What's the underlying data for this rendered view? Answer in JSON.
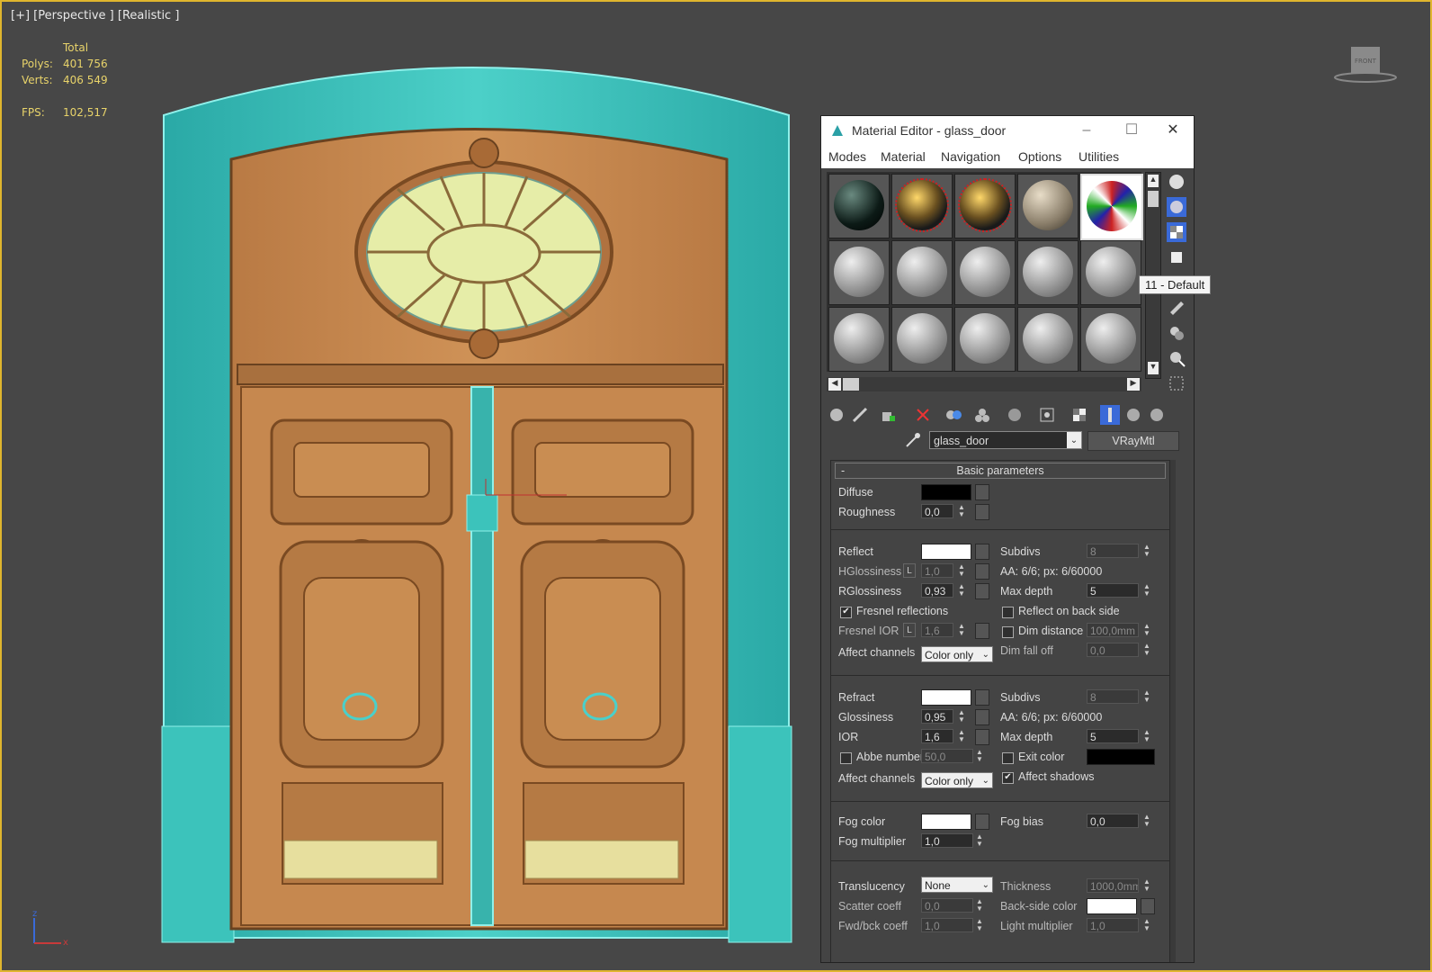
{
  "viewport": {
    "label": "[+] [Perspective ] [Realistic ]",
    "stats": {
      "header": "Total",
      "rows": [
        {
          "key": "Polys:",
          "value": "401 756"
        },
        {
          "key": "Verts:",
          "value": "406 549"
        },
        {
          "key": "FPS:",
          "value": "102,517"
        }
      ]
    },
    "viewcube_label": "FRONT",
    "axis": {
      "z": "z",
      "x": "x"
    }
  },
  "material_editor": {
    "title": "Material Editor - glass_door",
    "menu": [
      "Modes",
      "Material",
      "Navigation",
      "Options",
      "Utilities"
    ],
    "tooltip": "11 - Default",
    "material_name": "glass_door",
    "material_type": "VRayMtl",
    "rollout_title": "Basic parameters",
    "diffuse": {
      "label": "Diffuse",
      "color": "#000000"
    },
    "roughness": {
      "label": "Roughness",
      "value": "0,0"
    },
    "reflect": {
      "label": "Reflect",
      "color": "#ffffff",
      "hgloss_label": "HGlossiness",
      "hgloss_lock": "L",
      "hgloss_value": "1,0",
      "rgloss_label": "RGlossiness",
      "rgloss_value": "0,93",
      "fresnel_label": "Fresnel reflections",
      "fresnel_checked": "✔",
      "fresnel_ior_label": "Fresnel IOR",
      "fresnel_ior_lock": "L",
      "fresnel_ior_value": "1,6",
      "affect_label": "Affect channels",
      "affect_value": "Color only",
      "subdivs_label": "Subdivs",
      "subdivs_value": "8",
      "aa": "AA: 6/6; px: 6/60000",
      "maxdepth_label": "Max depth",
      "maxdepth_value": "5",
      "backside_label": "Reflect on back side",
      "dimdist_label": "Dim distance",
      "dimdist_value": "100,0mm",
      "dimfall_label": "Dim fall off",
      "dimfall_value": "0,0"
    },
    "refract": {
      "label": "Refract",
      "color": "#ffffff",
      "gloss_label": "Glossiness",
      "gloss_value": "0,95",
      "ior_label": "IOR",
      "ior_value": "1,6",
      "abbe_label": "Abbe number",
      "abbe_value": "50,0",
      "affect_label": "Affect channels",
      "affect_value": "Color only",
      "subdivs_label": "Subdivs",
      "subdivs_value": "8",
      "aa": "AA: 6/6; px: 6/60000",
      "maxdepth_label": "Max depth",
      "maxdepth_value": "5",
      "exit_label": "Exit color",
      "exit_color": "#000000",
      "shadows_label": "Affect shadows",
      "shadows_checked": "✔"
    },
    "fog": {
      "color_label": "Fog color",
      "color": "#ffffff",
      "mult_label": "Fog multiplier",
      "mult_value": "1,0",
      "bias_label": "Fog bias",
      "bias_value": "0,0"
    },
    "translucency": {
      "label": "Translucency",
      "value": "None",
      "scatter_label": "Scatter coeff",
      "scatter_value": "0,0",
      "fwd_label": "Fwd/bck coeff",
      "fwd_value": "1,0",
      "thickness_label": "Thickness",
      "thickness_value": "1000,0mm",
      "backside_color_label": "Back-side color",
      "backside_color": "#ffffff",
      "light_mult_label": "Light multiplier",
      "light_mult_value": "1,0"
    }
  },
  "colors": {
    "frame": "#3ec2bb",
    "wood": "#c98a4f",
    "glass": "#e6eda8",
    "viewport_border": "#e0b62e"
  }
}
